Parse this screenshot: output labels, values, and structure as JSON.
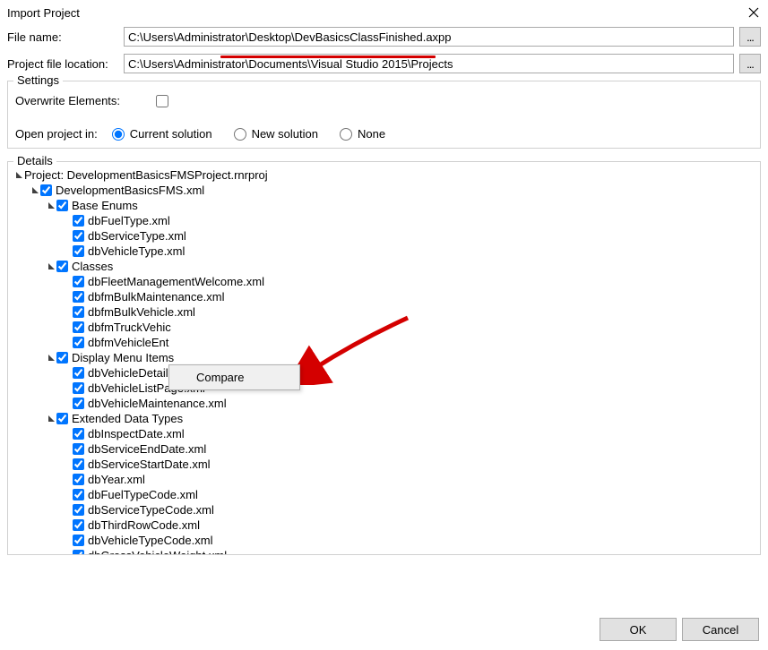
{
  "window": {
    "title": "Import Project"
  },
  "fields": {
    "filename_label": "File name:",
    "filename_value": "C:\\Users\\Administrator\\Desktop\\DevBasicsClassFinished.axpp",
    "location_label": "Project file location:",
    "location_value": "C:\\Users\\Administrator\\Documents\\Visual Studio 2015\\Projects"
  },
  "settings": {
    "group_label": "Settings",
    "overwrite_label": "Overwrite Elements:",
    "overwrite_checked": false,
    "open_in_label": "Open project in:",
    "radio_options": [
      {
        "value": "current",
        "label": "Current solution",
        "selected": true
      },
      {
        "value": "new",
        "label": "New solution",
        "selected": false
      },
      {
        "value": "none",
        "label": "None",
        "selected": false
      }
    ]
  },
  "details": {
    "group_label": "Details",
    "tree": [
      {
        "depth": 0,
        "expanded": true,
        "checked": null,
        "label": "Project: DevelopmentBasicsFMSProject.rnrproj"
      },
      {
        "depth": 1,
        "expanded": true,
        "checked": true,
        "label": "DevelopmentBasicsFMS.xml"
      },
      {
        "depth": 2,
        "expanded": true,
        "checked": true,
        "label": "Base Enums"
      },
      {
        "depth": 3,
        "expanded": null,
        "checked": true,
        "label": "dbFuelType.xml"
      },
      {
        "depth": 3,
        "expanded": null,
        "checked": true,
        "label": "dbServiceType.xml"
      },
      {
        "depth": 3,
        "expanded": null,
        "checked": true,
        "label": "dbVehicleType.xml"
      },
      {
        "depth": 2,
        "expanded": true,
        "checked": true,
        "label": "Classes"
      },
      {
        "depth": 3,
        "expanded": null,
        "checked": true,
        "label": "dbFleetManagementWelcome.xml"
      },
      {
        "depth": 3,
        "expanded": null,
        "checked": true,
        "label": "dbfmBulkMaintenance.xml"
      },
      {
        "depth": 3,
        "expanded": null,
        "checked": true,
        "label": "dbfmBulkVehicle.xml"
      },
      {
        "depth": 3,
        "expanded": null,
        "checked": true,
        "label": "dbfmTruckVehic"
      },
      {
        "depth": 3,
        "expanded": null,
        "checked": true,
        "label": "dbfmVehicleEnt"
      },
      {
        "depth": 2,
        "expanded": true,
        "checked": true,
        "label": "Display Menu Items"
      },
      {
        "depth": 3,
        "expanded": null,
        "checked": true,
        "label": "dbVehicleDetails.xml"
      },
      {
        "depth": 3,
        "expanded": null,
        "checked": true,
        "label": "dbVehicleListPage.xml"
      },
      {
        "depth": 3,
        "expanded": null,
        "checked": true,
        "label": "dbVehicleMaintenance.xml"
      },
      {
        "depth": 2,
        "expanded": true,
        "checked": true,
        "label": "Extended Data Types"
      },
      {
        "depth": 3,
        "expanded": null,
        "checked": true,
        "label": "dbInspectDate.xml"
      },
      {
        "depth": 3,
        "expanded": null,
        "checked": true,
        "label": "dbServiceEndDate.xml"
      },
      {
        "depth": 3,
        "expanded": null,
        "checked": true,
        "label": "dbServiceStartDate.xml"
      },
      {
        "depth": 3,
        "expanded": null,
        "checked": true,
        "label": "dbYear.xml"
      },
      {
        "depth": 3,
        "expanded": null,
        "checked": true,
        "label": "dbFuelTypeCode.xml"
      },
      {
        "depth": 3,
        "expanded": null,
        "checked": true,
        "label": "dbServiceTypeCode.xml"
      },
      {
        "depth": 3,
        "expanded": null,
        "checked": true,
        "label": "dbThirdRowCode.xml"
      },
      {
        "depth": 3,
        "expanded": null,
        "checked": true,
        "label": "dbVehicleTypeCode.xml"
      },
      {
        "depth": 3,
        "expanded": null,
        "checked": true,
        "label": "dbGrossVehicleWeight.xml"
      }
    ]
  },
  "context_menu": {
    "compare": "Compare"
  },
  "buttons": {
    "ok": "OK",
    "cancel": "Cancel"
  }
}
